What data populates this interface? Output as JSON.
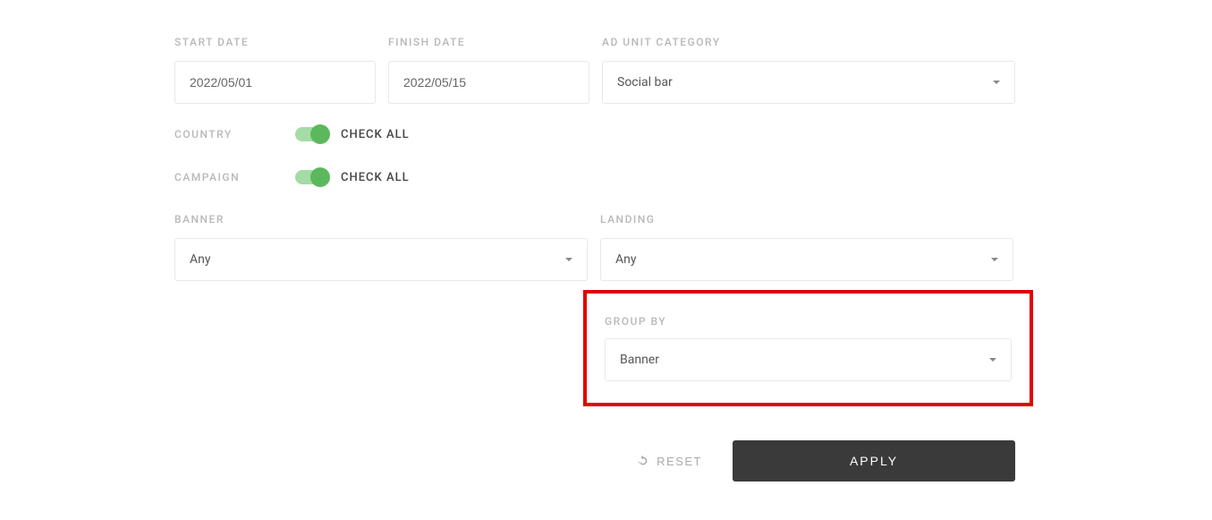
{
  "start_date": {
    "label": "START DATE",
    "value": "2022/05/01"
  },
  "finish_date": {
    "label": "FINISH DATE",
    "value": "2022/05/15"
  },
  "ad_unit_category": {
    "label": "AD UNIT CATEGORY",
    "value": "Social bar"
  },
  "country": {
    "label": "COUNTRY",
    "check_label": "CHECK ALL"
  },
  "campaign": {
    "label": "CAMPAIGN",
    "check_label": "CHECK ALL"
  },
  "banner": {
    "label": "BANNER",
    "value": "Any"
  },
  "landing": {
    "label": "LANDING",
    "value": "Any"
  },
  "group_by": {
    "label": "GROUP BY",
    "value": "Banner"
  },
  "actions": {
    "reset": "RESET",
    "apply": "APPLY"
  }
}
